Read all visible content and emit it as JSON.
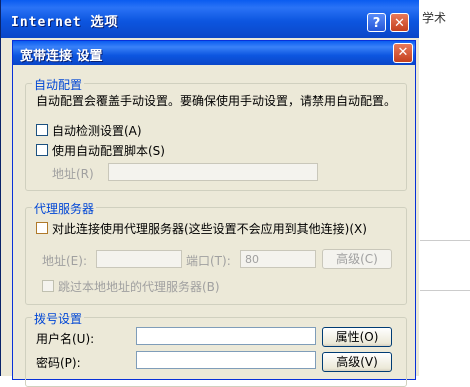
{
  "background_window": {
    "title": "Internet 选项",
    "help_glyph": "?",
    "close_glyph": "✕",
    "right_text": "学术"
  },
  "dialog": {
    "title": "宽带连接 设置",
    "close_glyph": "✕",
    "auto_config": {
      "group_title": "自动配置",
      "description": "自动配置会覆盖手动设置。要确保使用手动设置，请禁用自动配置。",
      "auto_detect_label": "自动检测设置(A)",
      "auto_script_label": "使用自动配置脚本(S)",
      "address_label": "地址(R)",
      "address_value": ""
    },
    "proxy": {
      "group_title": "代理服务器",
      "use_proxy_label": "对此连接使用代理服务器(这些设置不会应用到其他连接)(X)",
      "address_label": "地址(E):",
      "address_value": "",
      "port_label": "端口(T):",
      "port_value": "80",
      "advanced_label": "高级(C)",
      "bypass_label": "跳过本地地址的代理服务器(B)"
    },
    "dialup": {
      "group_title": "拨号设置",
      "username_label": "用户名(U):",
      "username_value": "",
      "properties_label": "属性(O)",
      "password_label": "密码(P):",
      "password_value": "",
      "advanced_label": "高级(V)"
    }
  }
}
